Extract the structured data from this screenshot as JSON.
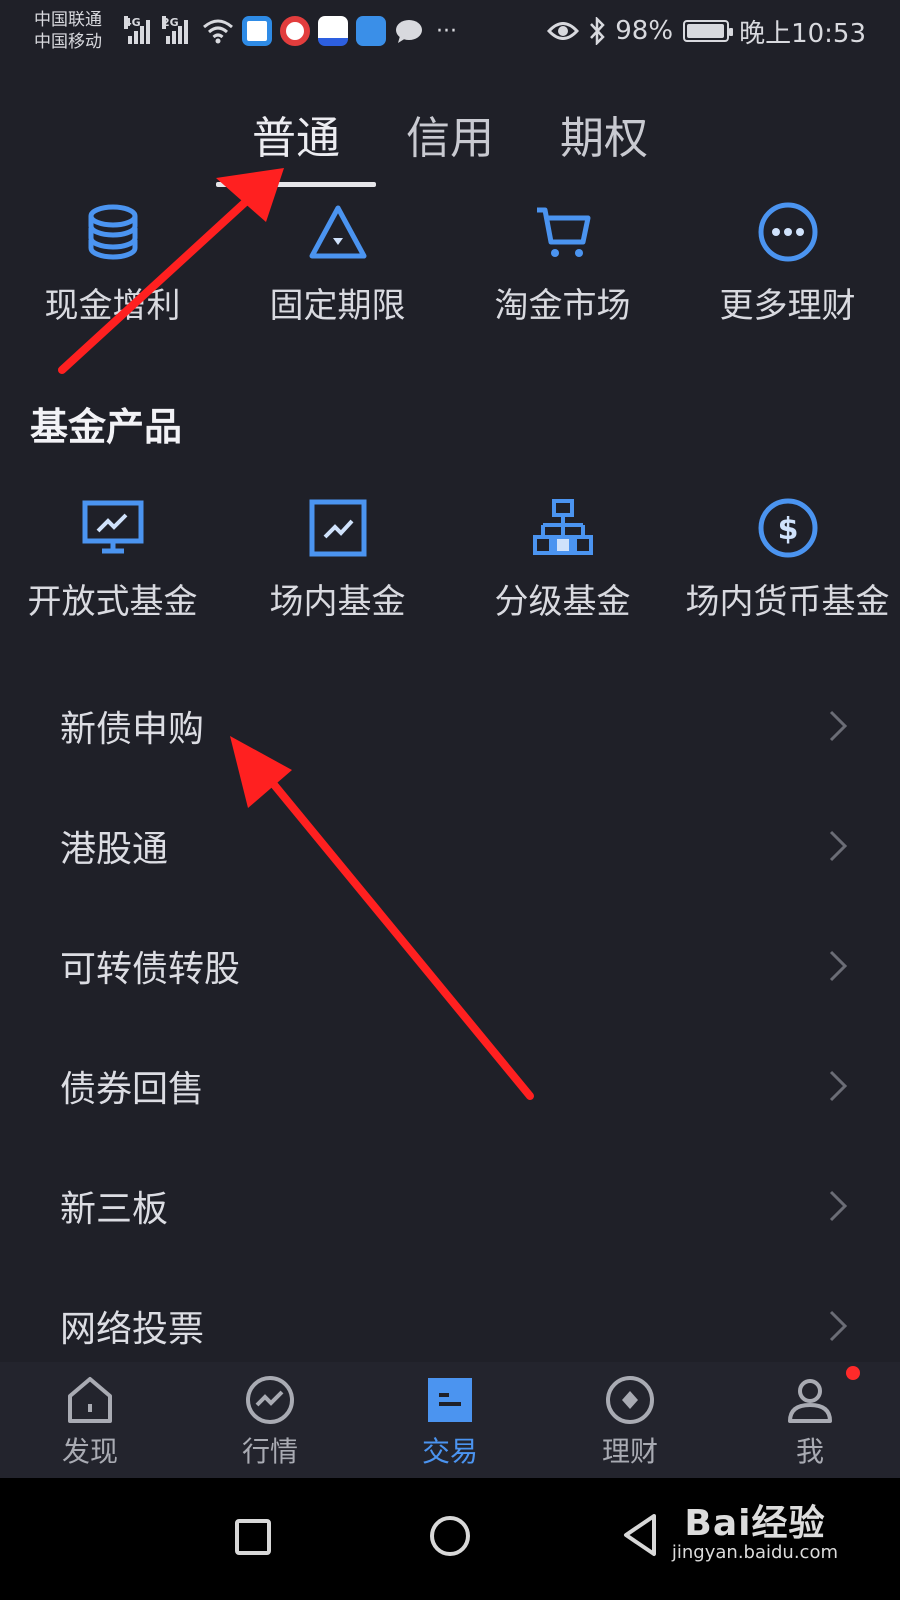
{
  "status_bar": {
    "carrier_1": "中国联通",
    "carrier_2": "中国移动",
    "net_1": "4G",
    "net_2": "2G",
    "battery": "98%",
    "time": "晚上10:53",
    "more": "···"
  },
  "tabs": [
    {
      "label": "普通"
    },
    {
      "label": "信用"
    },
    {
      "label": "期权"
    }
  ],
  "wealth_grid": [
    {
      "label": "现金增利",
      "icon": "coin-stack-icon"
    },
    {
      "label": "固定期限",
      "icon": "triangle-icon"
    },
    {
      "label": "淘金市场",
      "icon": "cart-icon"
    },
    {
      "label": "更多理财",
      "icon": "more-circle-icon"
    }
  ],
  "fund_section": {
    "title": "基金产品",
    "items": [
      {
        "label": "开放式基金",
        "icon": "monitor-chart-icon"
      },
      {
        "label": "场内基金",
        "icon": "chart-box-icon"
      },
      {
        "label": "分级基金",
        "icon": "hierarchy-icon"
      },
      {
        "label": "场内货币基金",
        "icon": "dollar-circle-icon"
      }
    ]
  },
  "list_items": [
    {
      "label": "新债申购"
    },
    {
      "label": "港股通"
    },
    {
      "label": "可转债转股"
    },
    {
      "label": "债券回售"
    },
    {
      "label": "新三板"
    },
    {
      "label": "网络投票"
    }
  ],
  "bottom_nav": [
    {
      "label": "发现",
      "icon": "home-icon"
    },
    {
      "label": "行情",
      "icon": "market-icon"
    },
    {
      "label": "交易",
      "icon": "trade-icon",
      "active": true
    },
    {
      "label": "理财",
      "icon": "compass-icon"
    },
    {
      "label": "我",
      "icon": "user-icon",
      "badge": true
    }
  ],
  "watermark": {
    "main": "Bai经验",
    "sub": "jingyan.baidu.com"
  },
  "colors": {
    "background": "#1f2028",
    "accent": "#4b94f0",
    "arrow": "#ff2020",
    "badge": "#ff2a2a"
  }
}
